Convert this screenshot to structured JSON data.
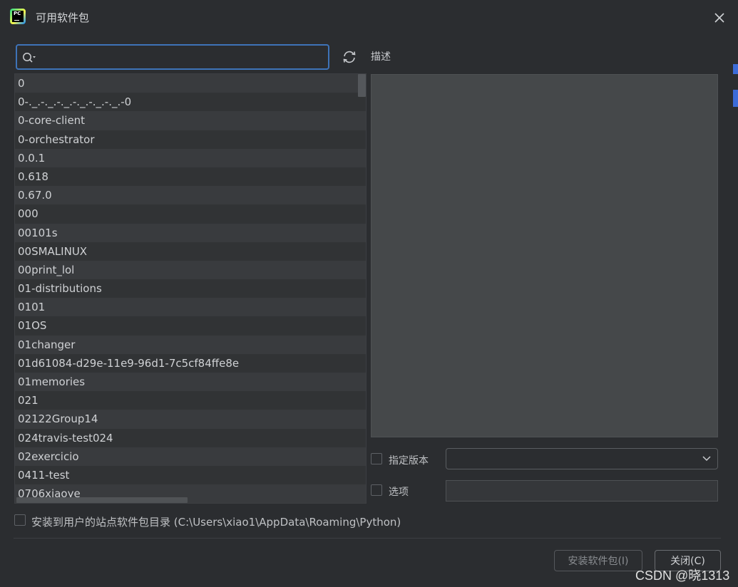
{
  "window": {
    "title": "可用软件包",
    "logo_text": "PC"
  },
  "search": {
    "placeholder": "",
    "value": ""
  },
  "packages": [
    "0",
    "0-._.-._.-._.-._.-._.-._.-0",
    "0-core-client",
    "0-orchestrator",
    "0.0.1",
    "0.618",
    "0.67.0",
    "000",
    "00101s",
    "00SMALINUX",
    "00print_lol",
    "01-distributions",
    "0101",
    "01OS",
    "01changer",
    "01d61084-d29e-11e9-96d1-7c5cf84ffe8e",
    "01memories",
    "021",
    "02122Group14",
    "024travis-test024",
    "02exercicio",
    "0411-test",
    "0706xiaoye"
  ],
  "description": {
    "label": "描述",
    "text": ""
  },
  "options": {
    "specify_version_label": "指定版本",
    "specify_version_checked": false,
    "version_value": "",
    "options_label": "选项",
    "options_checked": false,
    "options_value": ""
  },
  "install_to_user": {
    "label": "安装到用户的站点软件包目录 (C:\\Users\\xiao1\\AppData\\Roaming\\Python)",
    "checked": false
  },
  "buttons": {
    "install": "安装软件包(I)",
    "close": "关闭(C)"
  },
  "watermark": "CSDN @晓1313",
  "colors": {
    "background": "#2b2d30",
    "focus_border": "#3e73b8",
    "row_alt": "#393b3e"
  }
}
